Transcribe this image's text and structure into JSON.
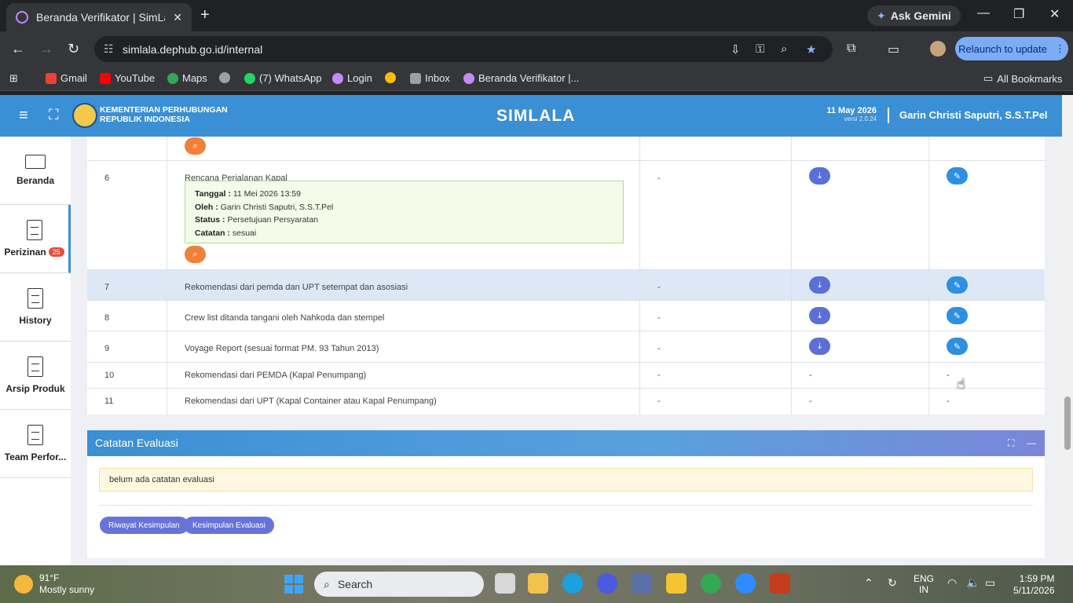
{
  "browser": {
    "tab_title": "Beranda Verifikator | SimLala",
    "new_tab": "+",
    "close_tab": "✕",
    "gemini_label": "Ask Gemini",
    "url": "simlala.dephub.go.id/internal",
    "relaunch_label": "Relaunch to update",
    "bookmarks": [
      {
        "label": "Gmail",
        "color": "#ea4335"
      },
      {
        "label": "YouTube",
        "color": "#ff0000"
      },
      {
        "label": "Maps",
        "color": "#34a853"
      },
      {
        "label": "",
        "color": "#9aa0a6"
      },
      {
        "label": "(7) WhatsApp",
        "color": "#25d366"
      },
      {
        "label": "Login",
        "color": "#c58af9"
      },
      {
        "label": "",
        "color": "#fbbc04"
      },
      {
        "label": "Inbox",
        "color": "#9aa0a6"
      },
      {
        "label": "Beranda Verifikator |...",
        "color": "#c58af9"
      }
    ],
    "all_bookmarks": "All Bookmarks"
  },
  "header": {
    "ministry_line1": "KEMENTERIAN PERHUBUNGAN",
    "ministry_line2": "REPUBLIK INDONESIA",
    "app_title": "SIMLALA",
    "date": "11 May 2026",
    "version": "versi 2.0.24",
    "user": "Garin Christi Saputri, S.S.T.Pel"
  },
  "sidebar": {
    "items": [
      {
        "label": "Beranda"
      },
      {
        "label": "Perizinan",
        "badge": "25"
      },
      {
        "label": "History"
      },
      {
        "label": "Arsip Produk"
      },
      {
        "label": "Team Perfor..."
      }
    ]
  },
  "table": {
    "rows": [
      {
        "no": "6",
        "name": "Rencana Perjalanan Kapal",
        "ket": "-",
        "info": {
          "tanggal_label": "Tanggal :",
          "tanggal": "11 Mei 2026 13:59",
          "oleh_label": "Oleh :",
          "oleh": "Garin Christi Saputri, S.S.T.Pel",
          "status_label": "Status :",
          "status": "Persetujuan Persyaratan",
          "catatan_label": "Catatan :",
          "catatan": "sesuai"
        }
      },
      {
        "no": "7",
        "name": "Rekomendasi dari pemda dan UPT setempat dan asosiasi",
        "ket": "-"
      },
      {
        "no": "8",
        "name": "Crew list ditanda tangani oleh Nahkoda dan stempel",
        "ket": "-"
      },
      {
        "no": "9",
        "name": "Voyage Report (sesuai format PM. 93 Tahun 2013)",
        "ket": "-"
      },
      {
        "no": "10",
        "name": "Rekomendasi dari PEMDA (Kapal Penumpang)",
        "ket": "-",
        "dl": "-",
        "act": "-"
      },
      {
        "no": "11",
        "name": "Rekomendasi dari UPT (Kapal Container atau Kapal Penumpang)",
        "ket": "-",
        "dl": "-",
        "act": "-"
      }
    ]
  },
  "evaluasi": {
    "title": "Catatan Evaluasi",
    "note": "belum ada catatan evaluasi",
    "btn_riwayat": "Riwayat Kesimpulan",
    "btn_kesimpulan": "Kesimpulan Evaluasi"
  },
  "taskbar": {
    "temp": "91°F",
    "weather": "Mostly sunny",
    "search_placeholder": "Search",
    "lang1": "ENG",
    "lang2": "IN",
    "time": "1:59 PM",
    "date": "5/11/2026"
  }
}
